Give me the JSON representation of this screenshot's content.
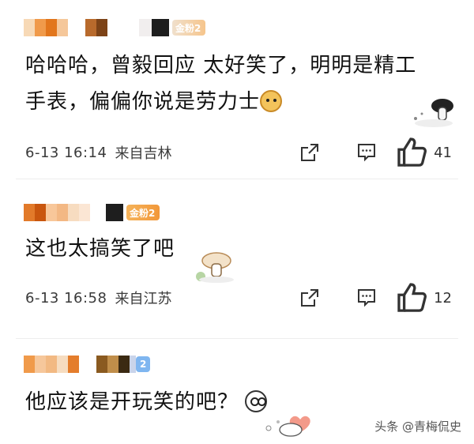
{
  "comments": [
    {
      "badge": "金粉2",
      "text_line1": "哈哈哈，曾毅回应 太好笑了，明明是精工",
      "text_line2": "手表，偏偏你说是劳力士",
      "time": "6-13 16:14",
      "location": "来自吉林",
      "likes": "41"
    },
    {
      "badge": "金粉2",
      "text_line1": "这也太搞笑了吧",
      "time": "6-13 16:58",
      "location": "来自江苏",
      "likes": "12"
    },
    {
      "badge": "2",
      "text_line1": "他应该是开玩笑的吧？"
    }
  ],
  "watermark": "头条 @青梅侃史",
  "icons": {
    "share": "share-icon",
    "comment": "comment-icon",
    "like": "thumbs-up-icon"
  },
  "colors": {
    "badge_gold": "#f2983a",
    "badge_blue": "#7fb6f0",
    "text": "#111111",
    "meta": "#3a3a3a"
  }
}
